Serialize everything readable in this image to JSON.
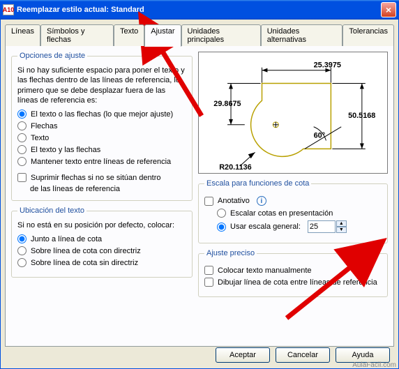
{
  "window": {
    "title": "Reemplazar estilo actual: Standard",
    "appicon": "A10"
  },
  "tabs": [
    "Líneas",
    "Símbolos y flechas",
    "Texto",
    "Ajustar",
    "Unidades principales",
    "Unidades alternativas",
    "Tolerancias"
  ],
  "active_tab": 3,
  "opciones": {
    "legend": "Opciones de ajuste",
    "desc": "Si no hay suficiente espacio para poner el texto y las flechas dentro de las líneas de referencia, lo primero que se debe desplazar fuera de las líneas de referencia es:",
    "r1": "El texto o las flechas (lo que mejor ajuste)",
    "r2": "Flechas",
    "r3": "Texto",
    "r4": "El texto y las flechas",
    "r5": "Mantener texto entre líneas de referencia",
    "c1": "Suprimir flechas si no se sitúan dentro",
    "c1b": "de las líneas de referencia"
  },
  "ubicacion": {
    "legend": "Ubicación del texto",
    "desc": "Si no está en su posición por defecto, colocar:",
    "r1": "Junto a línea de cota",
    "r2": "Sobre línea de cota con directriz",
    "r3": "Sobre línea de cota sin directriz"
  },
  "preview": {
    "d1": "25.3975",
    "d2": "29.8675",
    "d3": "50.5168",
    "ang": "60°",
    "rad": "R20.1136"
  },
  "escala": {
    "legend": "Escala para funciones de cota",
    "c1": "Anotativo",
    "r1": "Escalar cotas en presentación",
    "r2": "Usar escala general:",
    "value": "25"
  },
  "ajuste_preciso": {
    "legend": "Ajuste preciso",
    "c1": "Colocar texto manualmente",
    "c2": "Dibujar línea de cota entre líneas de referencia"
  },
  "buttons": {
    "ok": "Aceptar",
    "cancel": "Cancelar",
    "help": "Ayuda"
  },
  "watermark": "AulaFacil.com"
}
